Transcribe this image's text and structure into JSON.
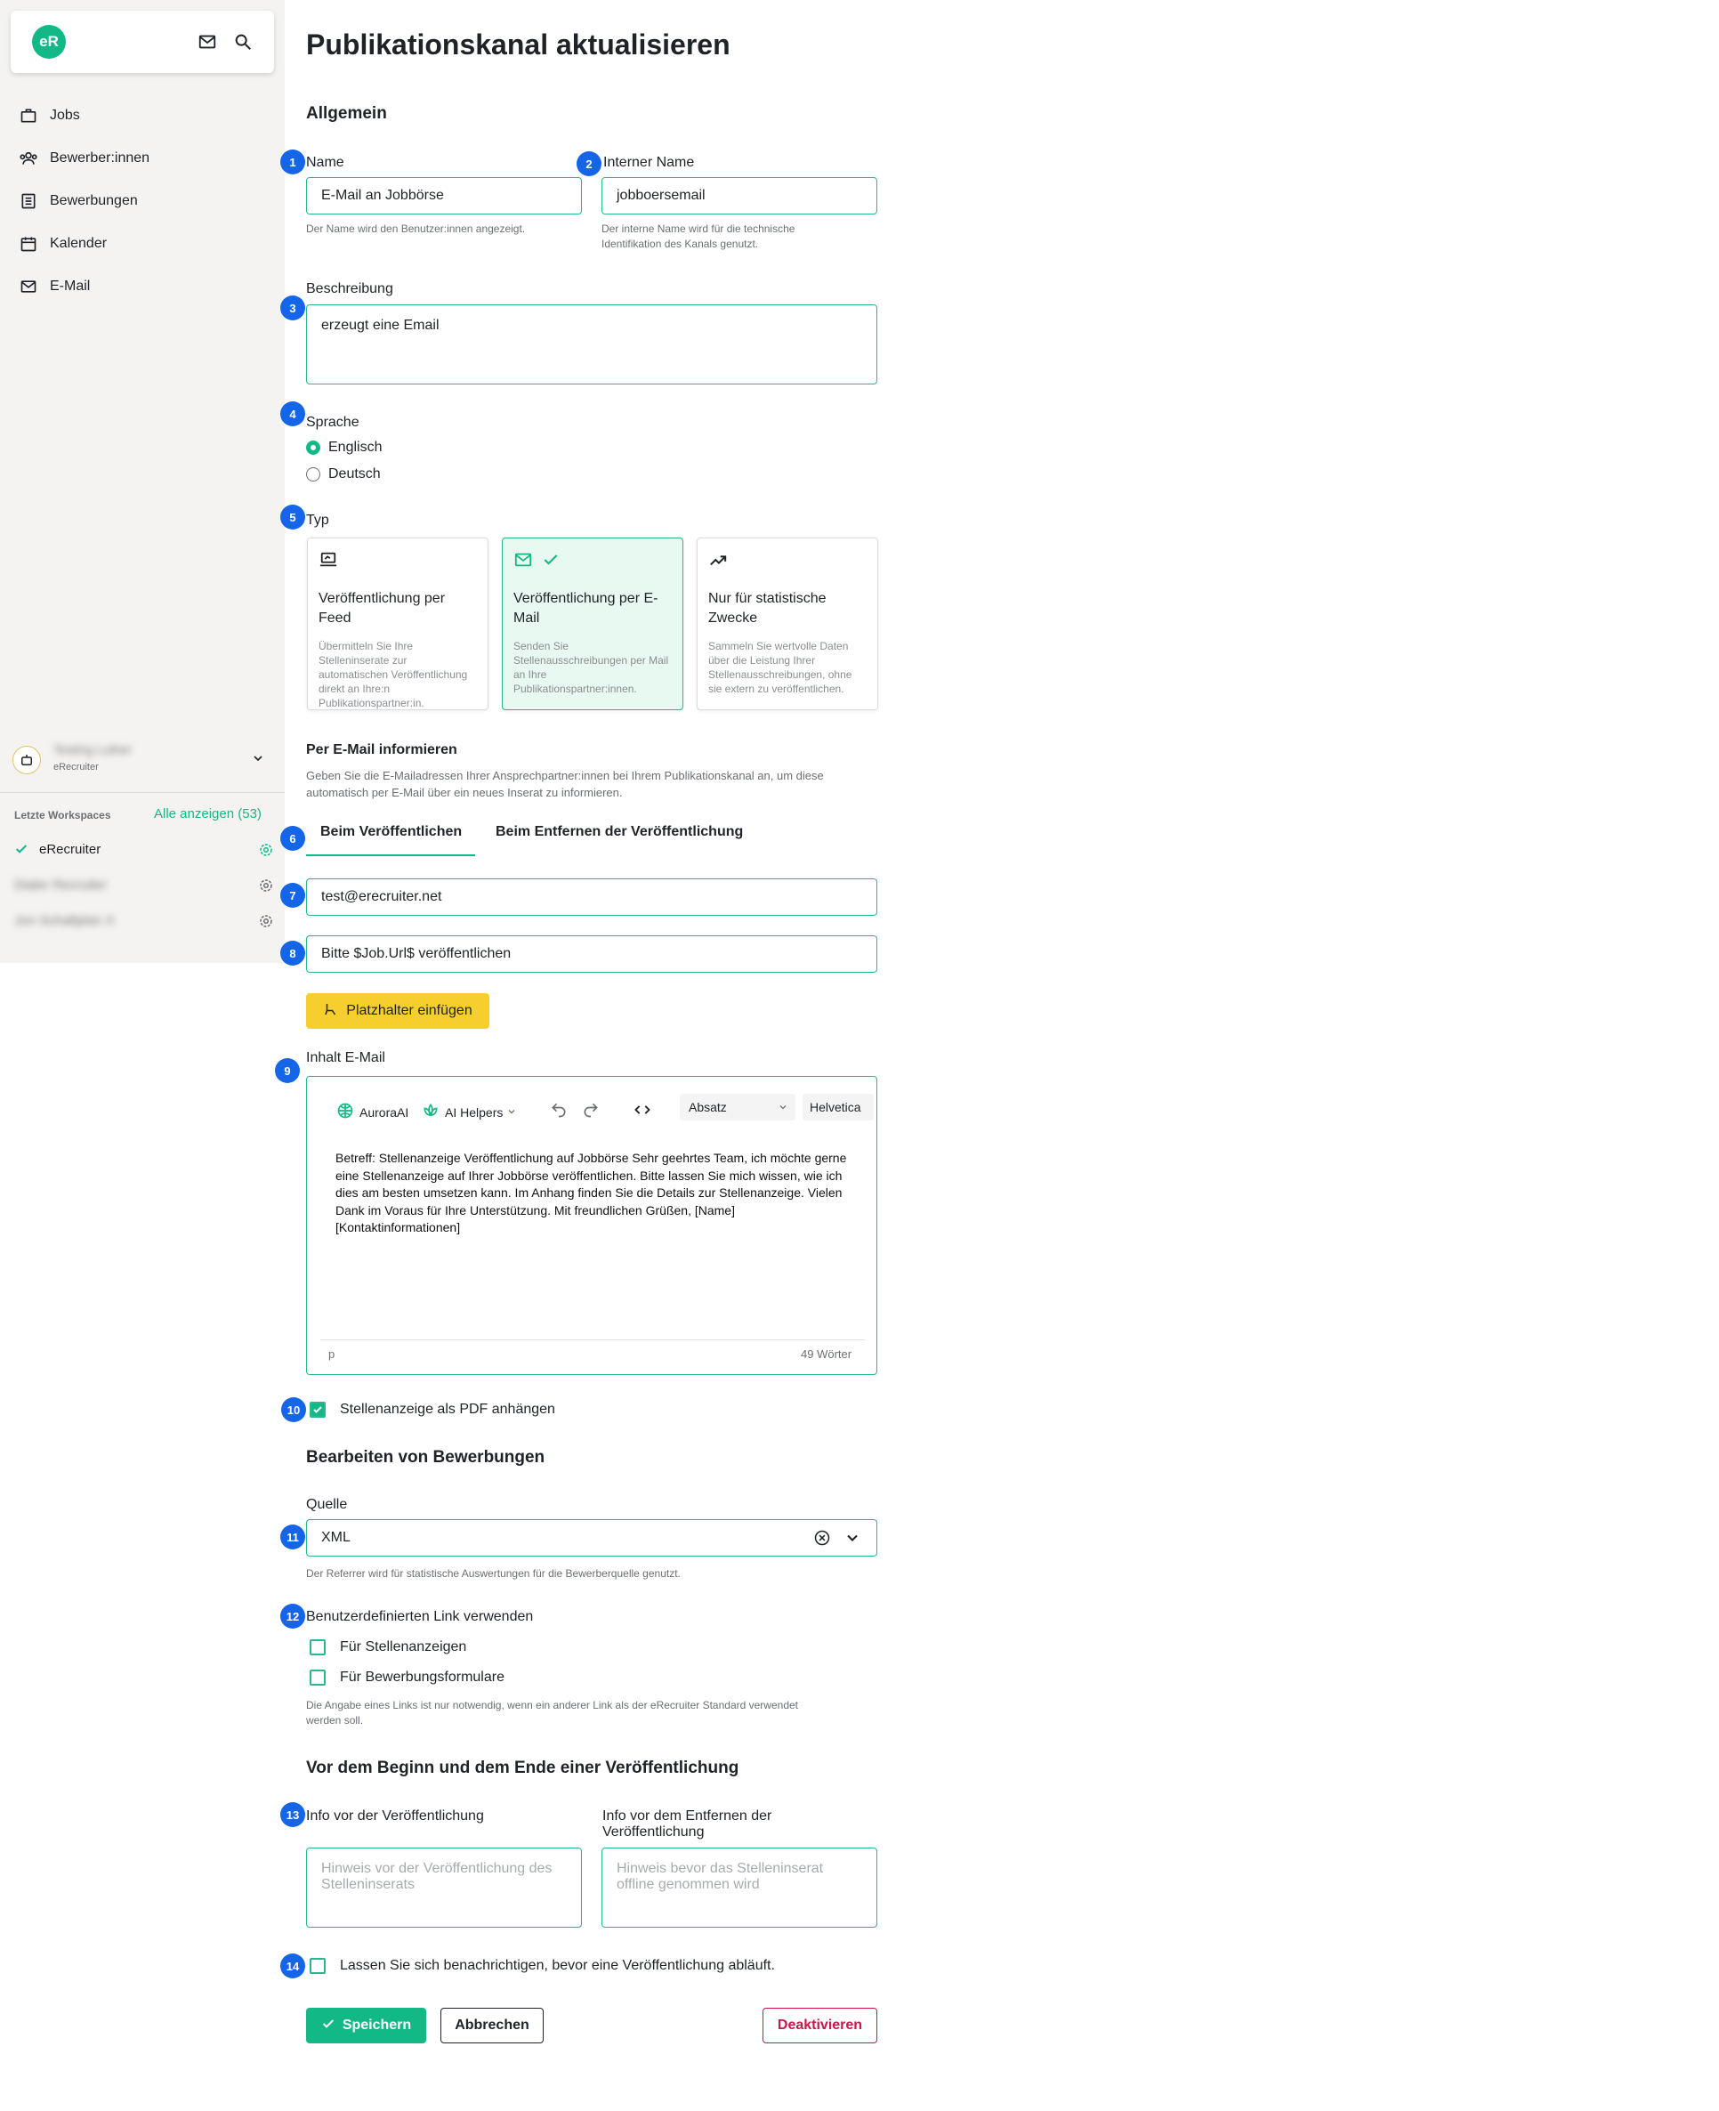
{
  "sidebar": {
    "logo": "eR",
    "nav": [
      {
        "label": "Jobs",
        "icon": "briefcase-icon"
      },
      {
        "label": "Bewerber:innen",
        "icon": "people-icon"
      },
      {
        "label": "Bewerbungen",
        "icon": "list-icon"
      },
      {
        "label": "Kalender",
        "icon": "calendar-icon"
      },
      {
        "label": "E-Mail",
        "icon": "mail-icon"
      }
    ],
    "account": {
      "name": "Testing Luther",
      "org": "eRecruiter"
    },
    "recent_label": "Letzte Workspaces",
    "show_all": "Alle anzeigen (53)",
    "workspaces": [
      "eRecruiter",
      "Dialer Recruiter",
      "Jon Schaltplan X"
    ]
  },
  "page": {
    "title": "Publikationskanal aktualisieren",
    "general_title": "Allgemein",
    "name_label": "Name",
    "name_value": "E-Mail an Jobbörse",
    "name_help": "Der Name wird den Benutzer:innen angezeigt.",
    "internal_label": "Interner Name",
    "internal_value": "jobboersemail",
    "internal_help_1": "Der interne Name wird für die technische",
    "internal_help_2": "Identifikation des Kanals genutzt.",
    "desc_label": "Beschreibung",
    "desc_value": "erzeugt eine Email",
    "lang_label": "Sprache",
    "lang_options": [
      "Englisch",
      "Deutsch"
    ],
    "lang_selected": "Englisch",
    "type_label": "Typ",
    "types": [
      {
        "title": "Veröffentlichung per Feed",
        "desc": "Übermitteln Sie Ihre Stelleninserate zur automatischen Veröffentlichung direkt an Ihre:n Publikationspartner:in.",
        "icon": "laptop-icon"
      },
      {
        "title": "Veröffentlichung per E-Mail",
        "desc": "Senden Sie Stellenausschreibungen per Mail an Ihre Publikationspartner:innen.",
        "icon": "mail-icon"
      },
      {
        "title": "Nur für statistische Zwecke",
        "desc": "Sammeln Sie wertvolle Daten über die Leistung Ihrer Stellenausschreibungen, ohne sie extern zu veröffentlichen.",
        "icon": "trend-icon"
      }
    ],
    "notify_title": "Per E-Mail informieren",
    "notify_help": "Geben Sie die E-Mailadressen Ihrer Ansprechpartner:innen bei Ihrem Publikationskanal an, um diese automatisch per E-Mail über ein neues Inserat zu informieren.",
    "tabs": [
      "Beim Veröffentlichen",
      "Beim Entfernen der Veröffentlichung"
    ],
    "email_value": "test@erecruiter.net",
    "subject_value": "Bitte $Job.Url$ veröffentlichen",
    "placeholder_btn": "Platzhalter einfügen",
    "content_label": "Inhalt E-Mail",
    "editor": {
      "aurora": "AuroraAI",
      "helpers": "AI Helpers",
      "format": "Absatz",
      "font": "Helvetica",
      "body": "Betreff: Stellenanzeige Veröffentlichung auf Jobbörse Sehr geehrtes Team, ich möchte gerne eine Stellenanzeige auf Ihrer Jobbörse veröffentlichen. Bitte lassen Sie mich wissen, wie ich dies am besten umsetzen kann. Im Anhang finden Sie die Details zur Stellenanzeige. Vielen Dank im Voraus für Ihre Unterstützung. Mit freundlichen Grüßen, [Name] [Kontaktinformationen]",
      "status_path": "p",
      "word_count": "49 Wörter"
    },
    "attach_pdf": "Stellenanzeige als PDF anhängen",
    "applications_title": "Bearbeiten von Bewerbungen",
    "source_label": "Quelle",
    "source_value": "XML",
    "source_help": "Der Referrer wird für statistische Auswertungen für die Bewerberquelle genutzt.",
    "custom_link_label": "Benutzerdefinierten Link verwenden",
    "custom_link_opts": [
      "Für Stellenanzeigen",
      "Für Bewerbungsformulare"
    ],
    "custom_link_help_1": "Die Angabe eines Links ist nur notwendig, wenn ein anderer Link als der eRecruiter Standard verwendet",
    "custom_link_help_2": "werden soll.",
    "before_title": "Vor dem Beginn und dem Ende einer Veröffentlichung",
    "info_before_label": "Info vor der Veröffentlichung",
    "info_before_ph": "Hinweis vor der Veröffentlichung des Stelleninserats",
    "info_remove_label_1": "Info vor dem Entfernen der",
    "info_remove_label_2": "Veröffentlichung",
    "info_remove_ph": "Hinweis bevor das Stelleninserat offline genommen wird",
    "expire_notify": "Lassen Sie sich benachrichtigen, bevor eine Veröffentlichung abläuft.",
    "save": "Speichern",
    "cancel": "Abbrechen",
    "deactivate": "Deaktivieren"
  },
  "badges": [
    "1",
    "2",
    "3",
    "4",
    "5",
    "6",
    "7",
    "8",
    "9",
    "10",
    "11",
    "12",
    "13",
    "14"
  ],
  "colors": {
    "accent": "#13b887",
    "badge": "#1565e8",
    "danger": "#c8174a",
    "yellow": "#f6cf2e"
  }
}
